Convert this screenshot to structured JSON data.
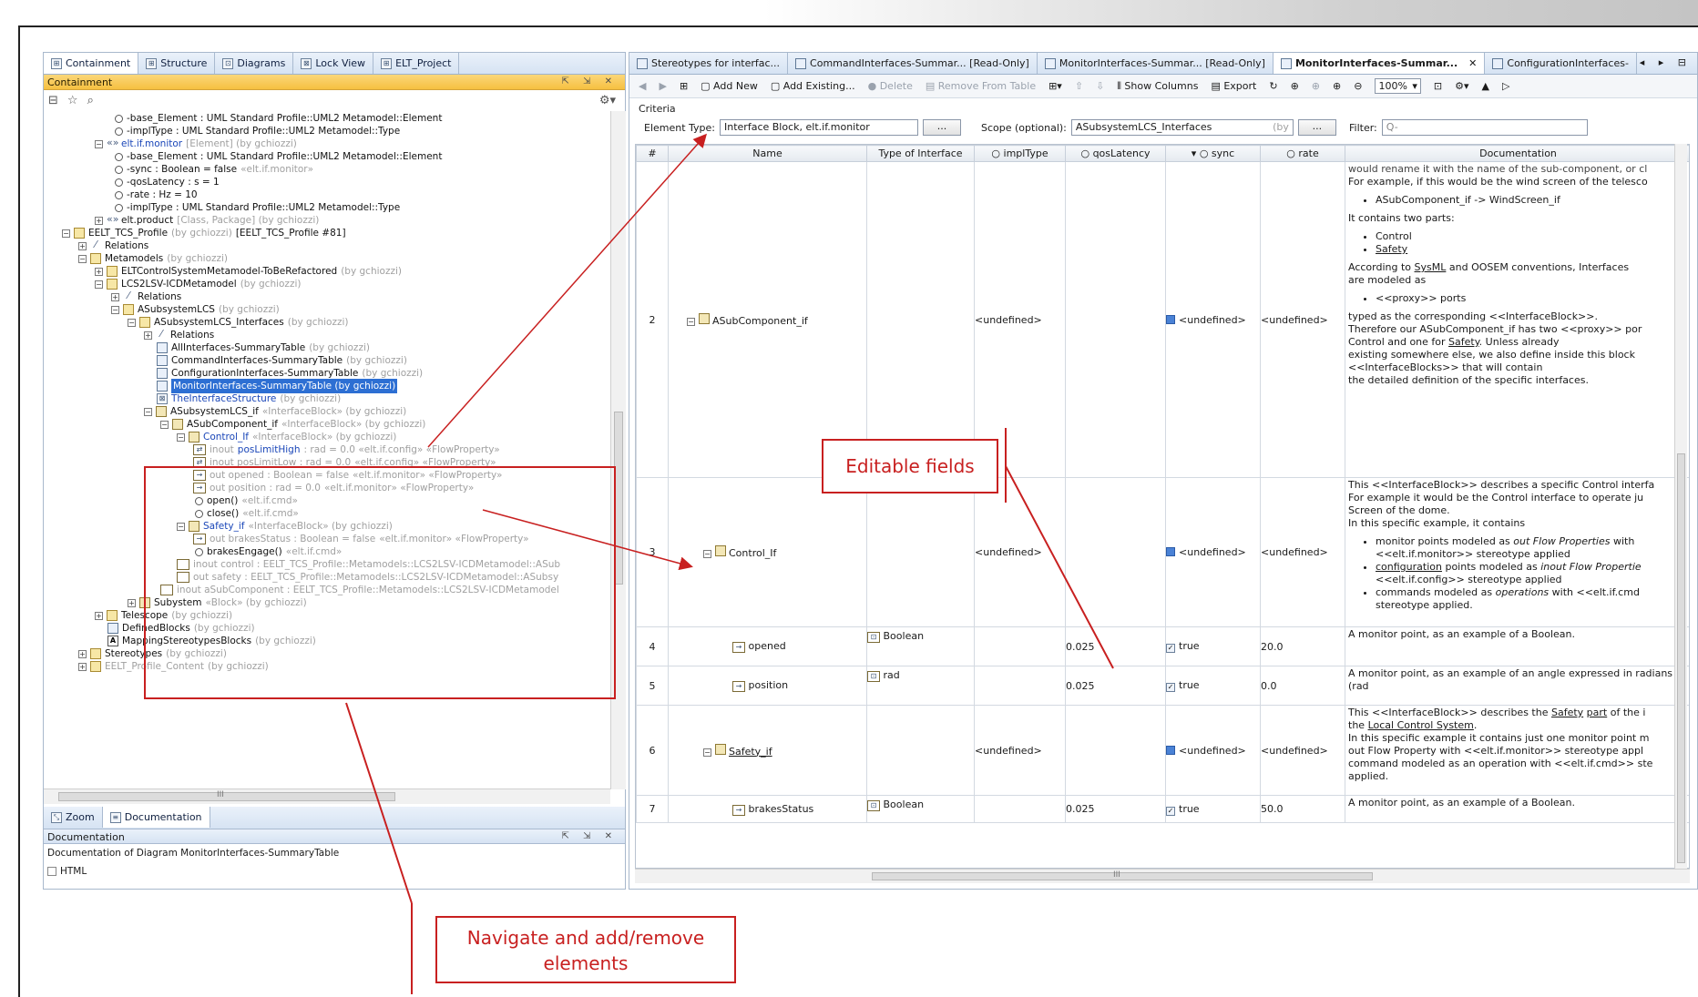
{
  "left": {
    "tabs": [
      "Containment",
      "Structure",
      "Diagrams",
      "Lock View",
      "ELT_Project"
    ],
    "panel_title": "Containment",
    "panel_ctrls": "⇱ ⇲ ✕",
    "tree": [
      {
        "t": "-base_Element : UML Standard Profile::UML2 Metamodel::Element"
      },
      {
        "t": "-implType : UML Standard Profile::UML2 Metamodel::Type"
      },
      {
        "t": "elt.if.monitor",
        "g": "[Element] (by gchiozzi)"
      },
      {
        "t": "-base_Element : UML Standard Profile::UML2 Metamodel::Element"
      },
      {
        "t": "-sync : Boolean = false",
        "g": "«elt.if.monitor»"
      },
      {
        "t": "-qosLatency : s = 1"
      },
      {
        "t": "-rate : Hz = 10"
      },
      {
        "t": "-implType : UML Standard Profile::UML2 Metamodel::Type"
      },
      {
        "t": "elt.product",
        "g": "[Class, Package] (by gchiozzi)"
      },
      {
        "t": "EELT_TCS_Profile",
        "g": "(by gchiozzi)",
        "t2": "[EELT_TCS_Profile #81]"
      },
      {
        "t": "Relations"
      },
      {
        "t": "Metamodels",
        "g": "(by gchiozzi)"
      },
      {
        "t": "ELTControlSystemMetamodel-ToBeRefactored",
        "g": "(by gchiozzi)"
      },
      {
        "t": "LCS2LSV-ICDMetamodel",
        "g": "(by gchiozzi)"
      },
      {
        "t": "Relations"
      },
      {
        "t": "ASubsystemLCS",
        "g": "(by gchiozzi)"
      },
      {
        "t": "ASubsystemLCS_Interfaces",
        "g": "(by gchiozzi)"
      },
      {
        "t": "Relations"
      },
      {
        "t": "AllInterfaces-SummaryTable",
        "g": "(by gchiozzi)"
      },
      {
        "t": "CommandInterfaces-SummaryTable",
        "g": "(by gchiozzi)"
      },
      {
        "t": "ConfigurationInterfaces-SummaryTable",
        "g": "(by gchiozzi)"
      },
      {
        "t": "MonitorInterfaces-SummaryTable (by gchiozzi)"
      },
      {
        "t": "TheInterfaceStructure",
        "g": "(by gchiozzi)"
      },
      {
        "t": "ASubsystemLCS_if",
        "g": "«InterfaceBlock» (by gchiozzi)"
      },
      {
        "t": "ASubComponent_if",
        "g": "«InterfaceBlock» (by gchiozzi)"
      },
      {
        "t": "Control_If",
        "g": "«InterfaceBlock» (by gchiozzi)"
      },
      {
        "t": "inout",
        "t2": "posLimitHigh",
        "g": ": rad = 0.0 «elt.if.config» «FlowProperty»"
      },
      {
        "t": "inout posLimitLow : rad = 0.0",
        "g": "«elt.if.config» «FlowProperty»"
      },
      {
        "t": "out opened : Boolean = false",
        "g": "«elt.if.monitor» «FlowProperty»"
      },
      {
        "t": "out position : rad = 0.0",
        "g": "«elt.if.monitor» «FlowProperty»"
      },
      {
        "t": "open()",
        "g": "«elt.if.cmd»"
      },
      {
        "t": "close()",
        "g": "«elt.if.cmd»"
      },
      {
        "t": "Safety_if",
        "g": "«InterfaceBlock» (by gchiozzi)"
      },
      {
        "t": "out brakesStatus : Boolean = false",
        "g": "«elt.if.monitor» «FlowProperty»"
      },
      {
        "t": "brakesEngage()",
        "g": "«elt.if.cmd»"
      },
      {
        "t": "inout control : EELT_TCS_Profile::Metamodels::LCS2LSV-ICDMetamodel::ASub"
      },
      {
        "t": "out safety : EELT_TCS_Profile::Metamodels::LCS2LSV-ICDMetamodel::ASubsy"
      },
      {
        "t": "inout aSubComponent : EELT_TCS_Profile::Metamodels::LCS2LSV-ICDMetamodel"
      },
      {
        "t": "Subystem",
        "g": "«Block» (by gchiozzi)"
      },
      {
        "t": "Telescope",
        "g": "(by gchiozzi)"
      },
      {
        "t": "DefinedBlocks",
        "g": "(by gchiozzi)"
      },
      {
        "t": "MappingStereotypesBlocks",
        "g": "(by gchiozzi)"
      },
      {
        "t": "Stereotypes",
        "g": "(by gchiozzi)"
      },
      {
        "t": "EELT_Profile_Content",
        "g": "(by gchiozzi)"
      }
    ],
    "hscroll_marker": "III",
    "bottom_tabs": [
      "Zoom",
      "Documentation"
    ],
    "doc_title": "Documentation",
    "doc_text": "Documentation of Diagram MonitorInterfaces-SummaryTable",
    "html_label": "HTML"
  },
  "right": {
    "tabs": [
      "Stereotypes for interfac...",
      "CommandInterfaces-Summar... [Read-Only]",
      "MonitorInterfaces-Summar... [Read-Only]",
      "MonitorInterfaces-Summar...",
      "ConfigurationInterfaces-"
    ],
    "tab_close": "✕",
    "tab_nav": "◂ ▸ ⊟",
    "toolbar": {
      "add_new": "Add New",
      "add_existing": "Add Existing...",
      "delete": "Delete",
      "remove": "Remove From Table",
      "show_columns": "Show Columns",
      "export": "Export",
      "zoom": "100%"
    },
    "criteria_label": "Criteria",
    "element_type_label": "Element Type:",
    "element_type_value": "Interface Block, elt.if.monitor",
    "scope_label": "Scope (optional):",
    "scope_value": "ASubsystemLCS_Interfaces",
    "scope_hint": "(by",
    "dots": "...",
    "filter_label": "Filter:",
    "filter_placeholder": "Q-",
    "columns": [
      "#",
      "Name",
      "Type of Interface",
      "implType",
      "qosLatency",
      "sync",
      "rate",
      "Documentation"
    ],
    "rows": [
      {
        "num": "2",
        "name": "ASubComponent_if",
        "type": "",
        "impl": "<undefined>",
        "qos": "",
        "sync": "<undefined>",
        "rate": "<undefined>"
      },
      {
        "num": "3",
        "name": "Control_If",
        "type": "",
        "impl": "<undefined>",
        "qos": "",
        "sync": "<undefined>",
        "rate": "<undefined>"
      },
      {
        "num": "4",
        "name": "opened",
        "type": "Boolean",
        "impl": "",
        "qos": "0.025",
        "sync": "true",
        "rate": "20.0",
        "doc": "A monitor point, as an example of a Boolean."
      },
      {
        "num": "5",
        "name": "position",
        "type": "rad",
        "impl": "",
        "qos": "0.025",
        "sync": "true",
        "rate": "0.0",
        "doc": "A monitor point, as an example of an angle expressed in radians (rad"
      },
      {
        "num": "6",
        "name": "Safety_if",
        "type": "",
        "impl": "<undefined>",
        "qos": "",
        "sync": "<undefined>",
        "rate": "<undefined>"
      },
      {
        "num": "7",
        "name": "brakesStatus",
        "type": "Boolean",
        "impl": "",
        "qos": "0.025",
        "sync": "true",
        "rate": "50.0",
        "doc": "A monitor point, as an example of a Boolean."
      }
    ],
    "doc2": {
      "l0": "would rename it with the name of the sub-component, or cl",
      "l1": "For example, if this would be the wind screen of the telesco",
      "b1": "ASubComponent_if -> WindScreen_if",
      "l2": "It contains two parts:",
      "b2": "Control",
      "b3": "Safety",
      "l3a": "According to",
      "l3b": "SysML",
      "l3c": "and OOSEM conventions, Interfaces",
      "l3d": "are modeled as",
      "b4": "<<proxy>> ports",
      "l4": "typed as the corresponding <<InterfaceBlock>>.",
      "l5": "Therefore our ASubComponent_if has two <<proxy>> por",
      "l6a": "Control and one for",
      "l6b": "Safety",
      "l6c": ". Unless already",
      "l7": "existing somewhere else, we also define inside this block",
      "l8": "<<InterfaceBlocks>> that will contain",
      "l9": "the detailed definition of the specific interfaces."
    },
    "doc3": {
      "l1": "This <<InterfaceBlock>> describes a specific Control interfa",
      "l2": "For example it would be the Control interface to operate ju",
      "l3": "Screen of the dome.",
      "l4": "In this specific example, it contains",
      "b1a": "monitor points modeled as",
      "b1b": "out Flow Properties",
      "b1c": "with",
      "b1d": "<<elt.if.monitor>> stereotype applied",
      "b2a": "configuration",
      "b2b": "points modeled as",
      "b2c": "inout Flow Propertie",
      "b2d": "<<elt.if.config>> stereotype applied",
      "b3a": "commands modeled as",
      "b3b": "operations",
      "b3c": "with <<elt.if.cmd",
      "b3d": "stereotype applied."
    },
    "doc6": {
      "l1a": "This <<InterfaceBlock>> describes the",
      "l1b": "Safety",
      "l1c": "part",
      "l1d": "of the i",
      "l2a": "the",
      "l2b": "Local Control System",
      "l2c": ".",
      "l3": "In this specific example it contains just one monitor point m",
      "l4": "out Flow Property with <<elt.if.monitor>> stereotype appl",
      "l5": "command modeled as an operation with <<elt.if.cmd>> ste",
      "l6": "applied."
    },
    "hscroll_marker": "III"
  },
  "annotations": {
    "editable": "Editable fields",
    "navigate_line1": "Navigate and add/remove",
    "navigate_line2": "elements",
    "color": "#c82020"
  },
  "colors": {
    "selection": "#2d6fd3",
    "title_orange": "#f6c040",
    "tab_blue": "#d6e3f3",
    "link_blue": "#1a46b8"
  }
}
